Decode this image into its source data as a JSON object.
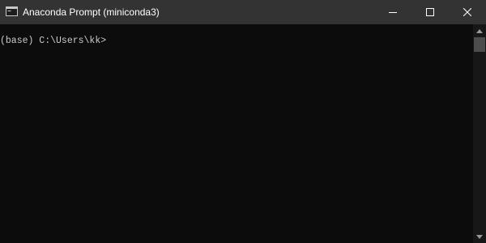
{
  "window": {
    "title": "Anaconda Prompt (miniconda3)",
    "app_icon": "console-icon",
    "controls": {
      "minimize_icon": "minimize-icon",
      "maximize_icon": "maximize-icon",
      "close_icon": "close-icon"
    }
  },
  "console": {
    "background": "#0c0c0c",
    "text_color": "#cccccc",
    "lines": [
      "(base) C:\\Users\\kk>"
    ]
  },
  "scrollbar": {
    "up_icon": "scroll-up-arrow-icon",
    "down_icon": "scroll-down-arrow-icon"
  },
  "colors": {
    "titlebar": "#333333",
    "close_hover": "#e81123"
  }
}
